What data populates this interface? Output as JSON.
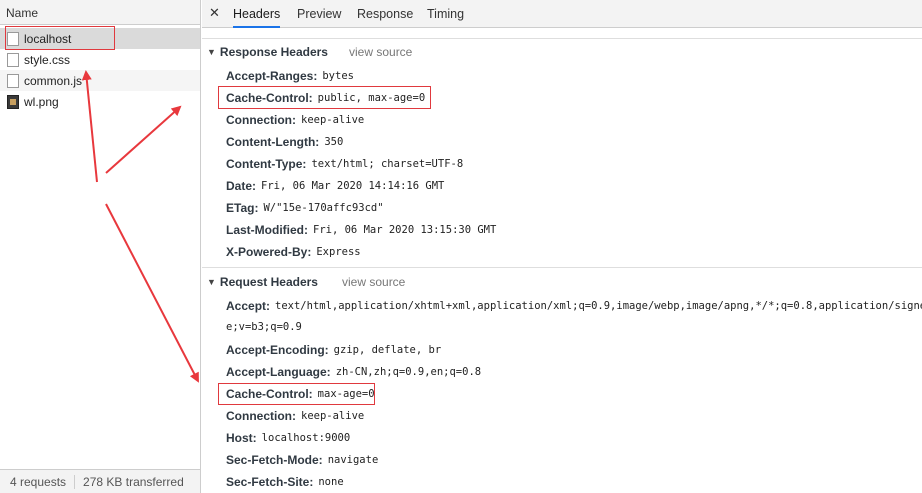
{
  "requests_panel": {
    "column_header": "Name",
    "files": [
      {
        "name": "localhost",
        "icon": "document-icon"
      },
      {
        "name": "style.css",
        "icon": "document-icon"
      },
      {
        "name": "common.js",
        "icon": "document-icon"
      },
      {
        "name": "wl.png",
        "icon": "image-icon"
      }
    ],
    "footer": {
      "requests": "4 requests",
      "transferred": "278 KB transferred"
    }
  },
  "details_panel": {
    "close_glyph": "✕",
    "tabs": [
      "Headers",
      "Preview",
      "Response",
      "Timing"
    ],
    "active_tab": "Headers",
    "response_headers": {
      "title": "Response Headers",
      "view_source": "view source",
      "rows": [
        {
          "name": "Accept-Ranges:",
          "value": "bytes"
        },
        {
          "name": "Cache-Control:",
          "value": "public, max-age=0"
        },
        {
          "name": "Connection:",
          "value": "keep-alive"
        },
        {
          "name": "Content-Length:",
          "value": "350"
        },
        {
          "name": "Content-Type:",
          "value": "text/html; charset=UTF-8"
        },
        {
          "name": "Date:",
          "value": "Fri, 06 Mar 2020 14:14:16 GMT"
        },
        {
          "name": "ETag:",
          "value": "W/\"15e-170affc93cd\""
        },
        {
          "name": "Last-Modified:",
          "value": "Fri, 06 Mar 2020 13:15:30 GMT"
        },
        {
          "name": "X-Powered-By:",
          "value": "Express"
        }
      ]
    },
    "request_headers": {
      "title": "Request Headers",
      "view_source": "view source",
      "rows": [
        {
          "name": "Accept:",
          "value": "text/html,application/xhtml+xml,application/xml;q=0.9,image/webp,image/apng,*/*;q=0.8,application/signed-exc",
          "continuation": "e;v=b3;q=0.9"
        },
        {
          "name": "Accept-Encoding:",
          "value": "gzip, deflate, br"
        },
        {
          "name": "Accept-Language:",
          "value": "zh-CN,zh;q=0.9,en;q=0.8"
        },
        {
          "name": "Cache-Control:",
          "value": "max-age=0"
        },
        {
          "name": "Connection:",
          "value": "keep-alive"
        },
        {
          "name": "Host:",
          "value": "localhost:9000"
        },
        {
          "name": "Sec-Fetch-Mode:",
          "value": "navigate"
        },
        {
          "name": "Sec-Fetch-Site:",
          "value": "none"
        }
      ]
    }
  },
  "annotation_color": "#e0393e"
}
